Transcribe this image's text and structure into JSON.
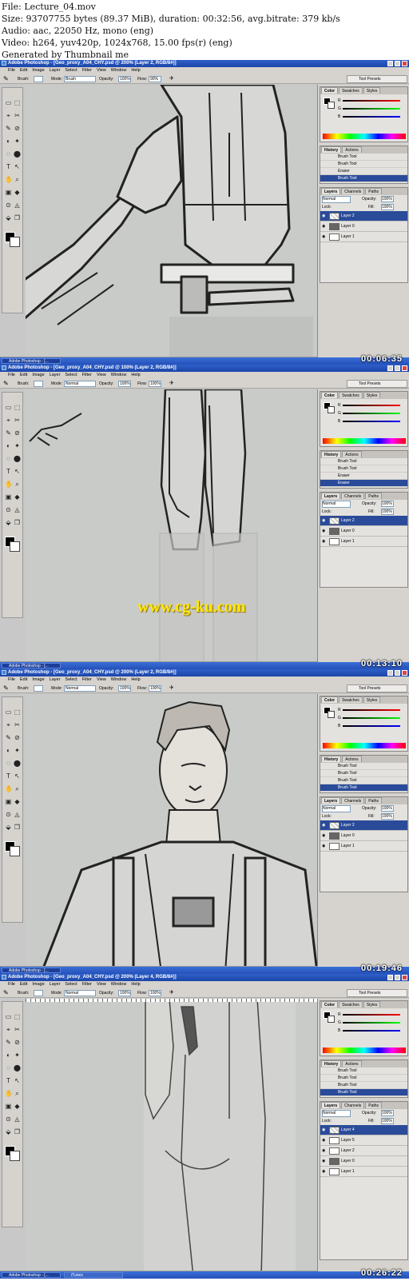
{
  "header": {
    "file_line": "File: Lecture_04.mov",
    "size_line": "Size: 93707755 bytes (89.37 MiB), duration: 00:32:56, avg.bitrate: 379 kb/s",
    "audio_line": "Audio: aac, 22050 Hz, mono (eng)",
    "video_line": "Video: h264, yuv420p, 1024x768, 15.00 fps(r) (eng)",
    "generated_line": "Generated by Thumbnail me"
  },
  "menu": [
    "File",
    "Edit",
    "Image",
    "Layer",
    "Select",
    "Filter",
    "View",
    "Window",
    "Help"
  ],
  "options": {
    "brush_label": "Brush:",
    "mode_label": "Mode:",
    "opacity_label": "Opacity:",
    "flow_label": "Flow:",
    "opacity_value": "100%",
    "panel_tab": "Tool Presets"
  },
  "color_panel": {
    "tabs": [
      "Color",
      "Swatches",
      "Styles"
    ],
    "channels": [
      "R",
      "G",
      "B"
    ]
  },
  "history_panel": {
    "tabs": [
      "History",
      "Actions"
    ]
  },
  "layers_panel": {
    "tabs": [
      "Layers",
      "Channels",
      "Paths"
    ],
    "blend": "Normal",
    "opacity_label": "Opacity:",
    "opacity_value": "100%",
    "lock_label": "Lock:",
    "fill_label": "Fill:",
    "fill_value": "100%"
  },
  "frames": [
    {
      "title": "Adobe Photoshop - [Geo_proxy_A04_CHY.psd @ 200% (Layer 2, RGB/8#)]",
      "mode_value": "Brush",
      "flow_value": "90%",
      "status_zoom": "200%",
      "status_doc": "Doc: 7.49M/7.31M",
      "history": [
        "Brush Tool",
        "Brush Tool",
        "Eraser",
        "Brush Tool"
      ],
      "layers": [
        "Layer 2",
        "Layer 0",
        "Layer 1"
      ],
      "taskbar": "Adobe Photoshop - [...",
      "timestamp": "00:06:35"
    },
    {
      "title": "Adobe Photoshop - [Geo_proxy_A04_CHY.psd @ 100% (Layer 2, RGB/8#)]",
      "mode_value": "Normal",
      "flow_value": "100%",
      "status_zoom": "100%",
      "status_doc": "Doc: 7.49M/8.83M",
      "history": [
        "Brush Tool",
        "Brush Tool",
        "Eraser",
        "Eraser"
      ],
      "layers": [
        "Layer 2",
        "Layer 0",
        "Layer 1"
      ],
      "taskbar": "Adobe Photoshop - [...",
      "timestamp": "00:13:10",
      "watermark": "www.cg-ku.com"
    },
    {
      "title": "Adobe Photoshop - [Geo_proxy_A04_CHY.psd @ 200% (Layer 2, RGB/8#)]",
      "mode_value": "Normal",
      "flow_value": "100%",
      "status_zoom": "200%",
      "status_doc": "Doc: 7.49M/8.84M",
      "history": [
        "Brush Tool",
        "Brush Tool",
        "Brush Tool",
        "Brush Tool"
      ],
      "layers": [
        "Layer 2",
        "Layer 0",
        "Layer 1"
      ],
      "taskbar": "Adobe Photoshop - [...",
      "timestamp": "00:19:46"
    },
    {
      "title": "Adobe Photoshop - [Geo_proxy_A04_CHY.psd @ 200% (Layer 4, RGB/8#)]",
      "mode_value": "Normal",
      "flow_value": "100%",
      "status_zoom": "200%",
      "status_doc": "Doc: 7.49M/14.2M",
      "history": [
        "Brush Tool",
        "Brush Tool",
        "Brush Tool",
        "Brush Tool"
      ],
      "layers": [
        "Layer 4",
        "Layer 5",
        "Layer 2",
        "Layer 0",
        "Layer 1"
      ],
      "taskbar": "Adobe Photoshop - [...",
      "taskbar2": "iTunes",
      "timestamp": "00:26:22"
    }
  ]
}
